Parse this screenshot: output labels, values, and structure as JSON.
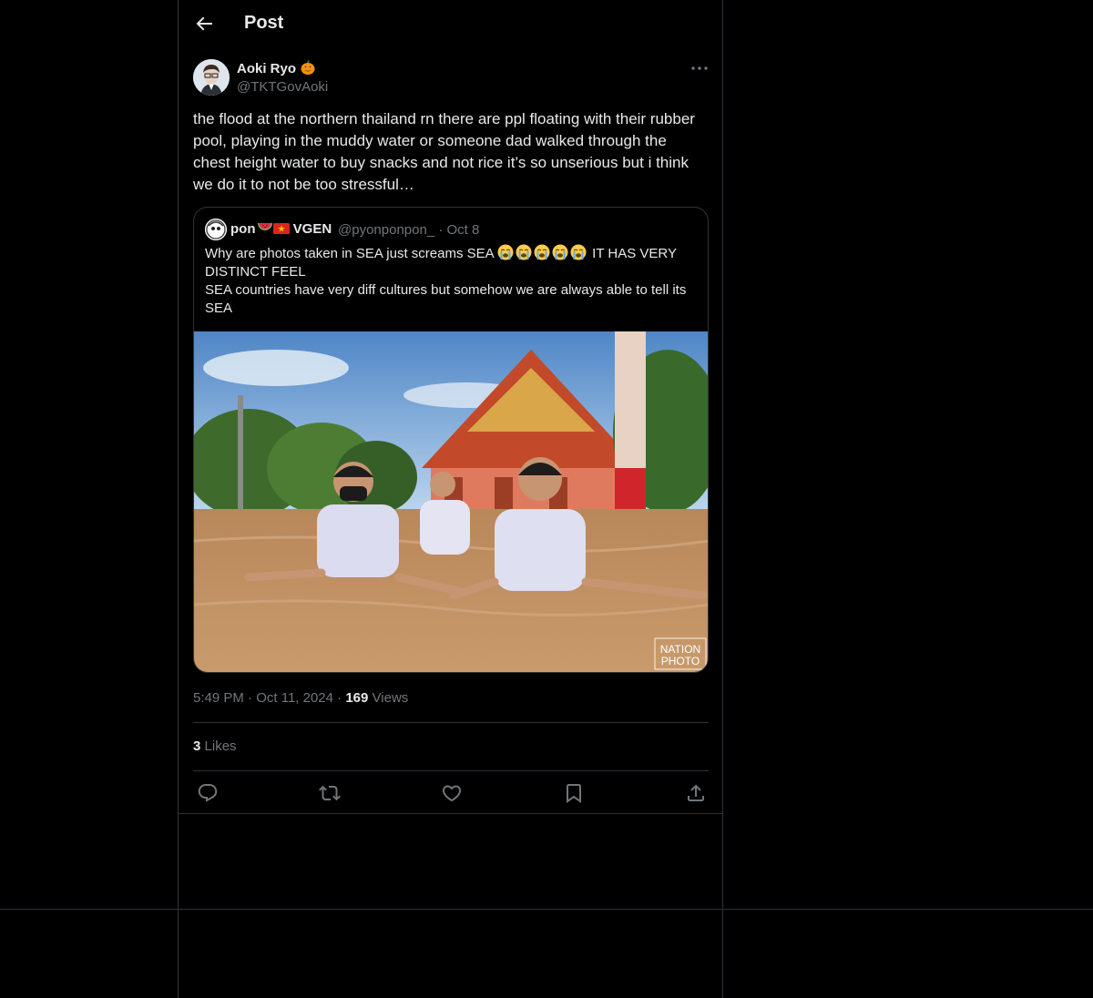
{
  "header": {
    "title": "Post"
  },
  "post": {
    "author_name": "Aoki Ryo",
    "author_handle": "@TKTGovAoki",
    "text": "the flood at the northern thailand rn there are ppl floating with their rubber pool, playing in the muddy water or someone dad walked through the chest height water to buy snacks and not rice it’s so unserious but i think we do it to not be too stressful…",
    "time": "5:49 PM",
    "date": "Oct 11, 2024",
    "views_count": "169",
    "views_label": "Views",
    "likes_count": "3",
    "likes_label": "Likes",
    "dot": "·"
  },
  "quote": {
    "author_name": "pon",
    "author_suffix": "VGEN",
    "author_handle": "@pyonponpon_",
    "date": "Oct 8",
    "text_part1": "Why are photos taken in SEA just screams SEA",
    "text_part2": "IT HAS VERY DISTINCT FEEL\nSEA countries have very diff cultures but somehow we are always able to tell its SEA",
    "image_watermark_line1": "NATION",
    "image_watermark_line2": "PHOTO"
  },
  "icons": {
    "back": "arrow-left-icon",
    "more": "more-horizontal-icon",
    "reply": "reply-icon",
    "repost": "repost-icon",
    "like": "heart-icon",
    "bookmark": "bookmark-icon",
    "share": "share-icon"
  },
  "colors": {
    "background": "#000000",
    "border": "#2f3336",
    "text": "#e7e9ea",
    "muted": "#71767b"
  }
}
